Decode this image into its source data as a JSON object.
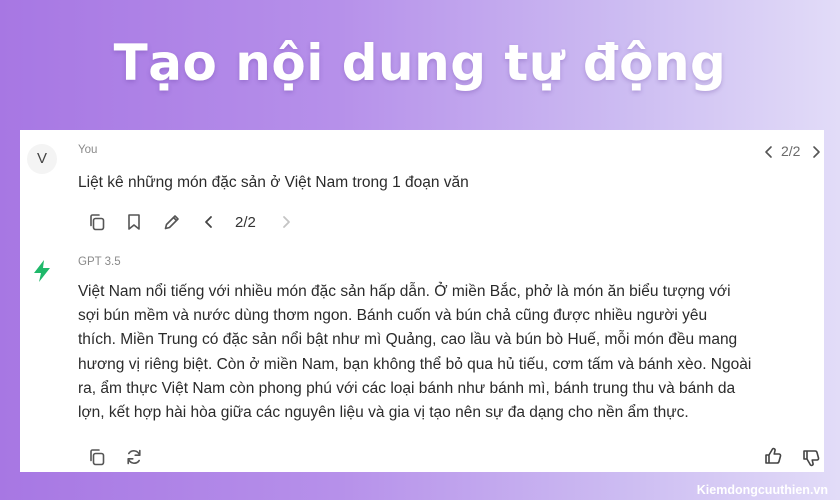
{
  "headline": "Tạo nội dung tự động",
  "user": {
    "avatar_letter": "V",
    "sender": "You",
    "message": "Liệt kê những món đặc sản ở Việt Nam trong 1 đoạn văn",
    "pager_top": "2/2",
    "pager": "2/2"
  },
  "assistant": {
    "sender": "GPT 3.5",
    "message": "Việt Nam nổi tiếng với nhiều món đặc sản hấp dẫn. Ở miền Bắc, phở là món ăn biểu tượng với\nsợi bún mềm và nước dùng thơm ngon. Bánh cuốn và bún chả cũng được nhiều người yêu\nthích. Miền Trung có đặc sản nổi bật như mì Quảng, cao lầu và bún bò Huế, mỗi món đều mang\nhương vị riêng biệt. Còn ở miền Nam, bạn không thể bỏ qua hủ tiếu, cơm tấm và bánh xèo. Ngoài\nra, ẩm thực Việt Nam còn phong phú với các loại bánh như bánh mì, bánh trung thu và bánh da\nlợn, kết hợp hài hòa giữa các nguyên liệu và gia vị tạo nên sự đa dạng cho nền ẩm thực."
  },
  "icons": {
    "user_actions": [
      "copy-icon",
      "bookmark-icon",
      "edit-icon",
      "chevron-left-icon",
      "chevron-right-icon"
    ],
    "assistant_actions": [
      "copy-icon",
      "regenerate-icon",
      "thumbs-up-icon",
      "thumbs-down-icon"
    ]
  },
  "colors": {
    "accent_green": "#1fb86a",
    "text": "#2b2b2b",
    "muted": "#8a8a8a"
  },
  "watermark": "Kiemdongcuuthien.vn"
}
